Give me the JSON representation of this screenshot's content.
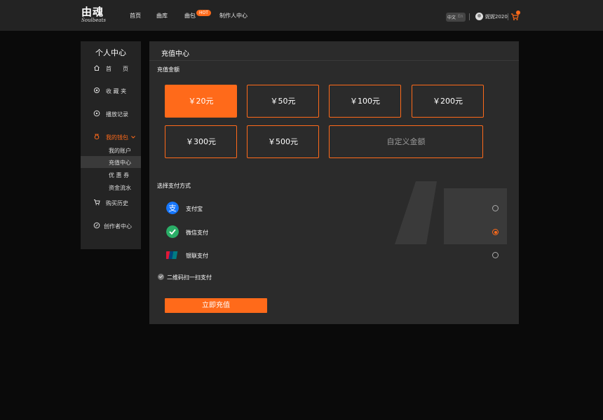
{
  "header": {
    "logo_text": "由魂",
    "logo_sub": "Soulbeats",
    "nav": [
      "首页",
      "曲库",
      "曲包",
      "制作人中心"
    ],
    "hot_badge": "HOT",
    "lang_cn": "中文",
    "lang_en": "En",
    "username": "妮妮2020",
    "cart_icon": "cart-icon"
  },
  "sidebar": {
    "title": "个人中心",
    "items": [
      {
        "label": "首　　页",
        "icon": "home-icon"
      },
      {
        "label": "收 藏 夹",
        "icon": "favorites-icon"
      },
      {
        "label": "播放记录",
        "icon": "play-history-icon"
      },
      {
        "label": "我的钱包",
        "icon": "wallet-icon"
      },
      {
        "label": "购买历史",
        "icon": "cart-icon"
      },
      {
        "label": "创作者中心",
        "icon": "creator-icon"
      }
    ],
    "wallet_sub": [
      "我的账户",
      "充值中心",
      "优 惠 券",
      "资金流水"
    ]
  },
  "main": {
    "title": "充值中心",
    "amount_label": "充值金额",
    "amounts": [
      "￥20元",
      "￥50元",
      "￥100元",
      "￥200元",
      "￥300元",
      "￥500元"
    ],
    "custom_amount": "自定义金额",
    "selected_amount": "￥20元",
    "payment_label": "选择支付方式",
    "payments": [
      {
        "label": "支付宝",
        "icon": "alipay-icon",
        "selected": false
      },
      {
        "label": "微信支付",
        "icon": "wechat-pay-icon",
        "selected": true
      },
      {
        "label": "银联支付",
        "icon": "unionpay-icon",
        "selected": false
      }
    ],
    "qr_label": "二维码扫一扫支付",
    "submit_label": "立即充值"
  },
  "colors": {
    "accent": "#ff6a1a",
    "panel": "#2b2b2b",
    "background": "#0a0a0a"
  }
}
